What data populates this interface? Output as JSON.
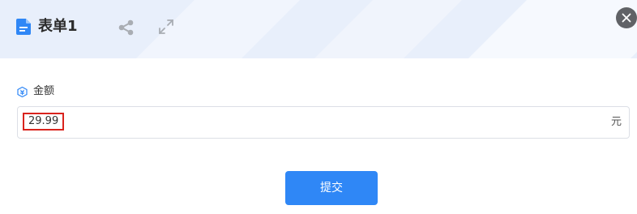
{
  "header": {
    "title": "表单1",
    "icons": {
      "form": "file-icon",
      "share": "share-icon",
      "expand": "expand-icon",
      "close": "close-icon"
    }
  },
  "field": {
    "label": "金额",
    "icon": "currency-icon",
    "value": "29.99",
    "unit": "元"
  },
  "submit": {
    "label": "提交"
  },
  "colors": {
    "accent": "#2f87f6",
    "highlight_border": "#d9231d",
    "header_bg": "#e8effb",
    "close_bg": "#606266"
  }
}
